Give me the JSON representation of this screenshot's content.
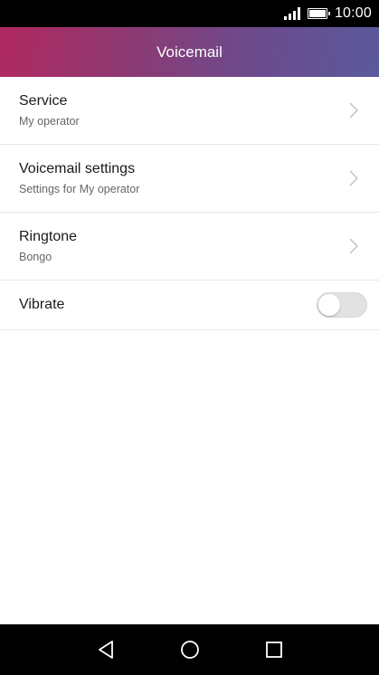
{
  "status_bar": {
    "time": "10:00",
    "icons": [
      "signal-icon",
      "battery-icon"
    ]
  },
  "app_bar": {
    "title": "Voicemail"
  },
  "settings": [
    {
      "label": "Service",
      "value": "My operator",
      "icon": "chevron-right-icon"
    },
    {
      "label": "Voicemail settings",
      "value": "Settings for My operator",
      "icon": "chevron-right-icon"
    },
    {
      "label": "Ringtone",
      "value": "Bongo",
      "icon": "chevron-right-icon"
    }
  ],
  "vibrate": {
    "label": "Vibrate",
    "enabled": false
  },
  "nav_bar": {
    "icons": [
      "back-icon",
      "home-icon",
      "recents-icon"
    ]
  },
  "colors": {
    "app_bar_gradient_start": "#b0285f",
    "app_bar_gradient_end": "#5a5a9c",
    "toggle_off": "#e2e2e2",
    "divider": "#e6e6e6"
  }
}
